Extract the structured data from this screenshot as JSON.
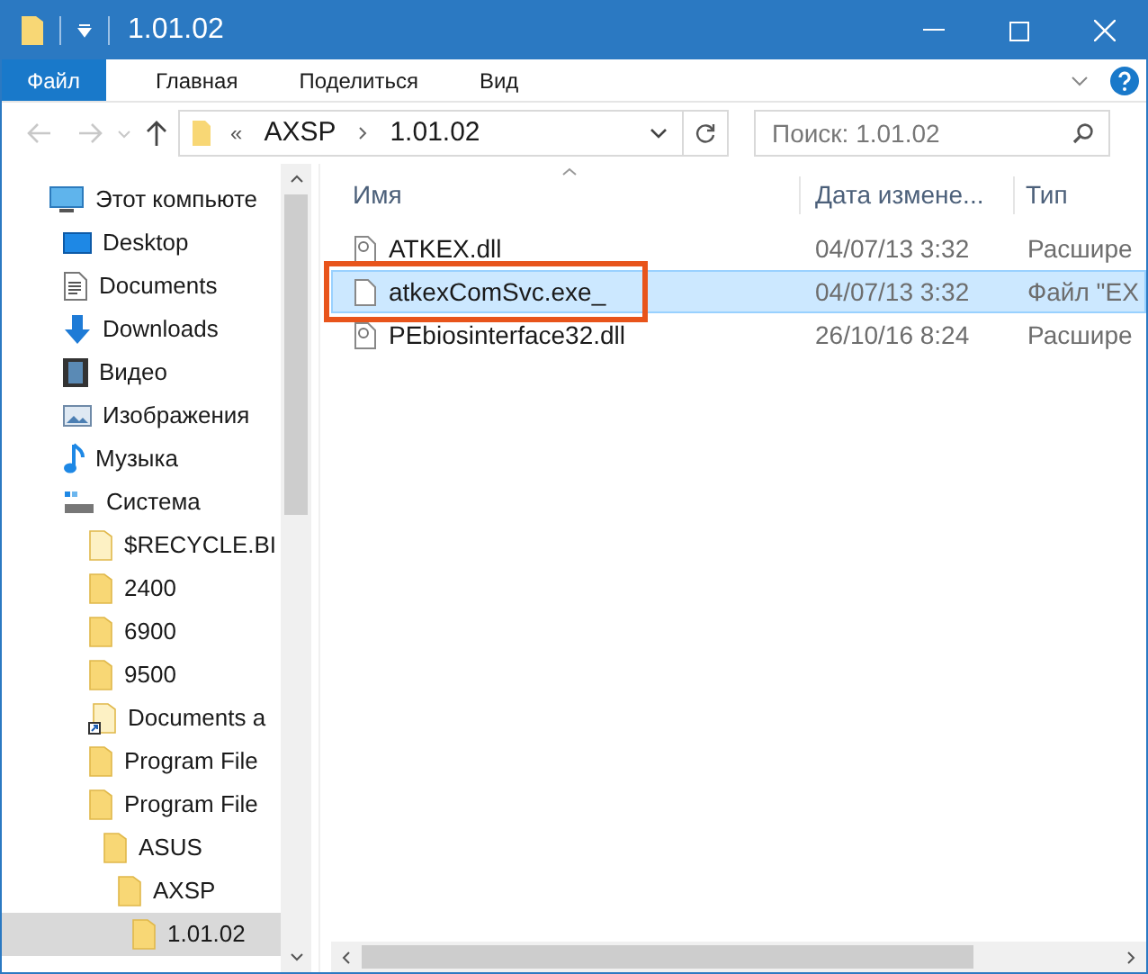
{
  "window": {
    "title": "1.01.02"
  },
  "ribbon_tabs": [
    {
      "label": "Файл",
      "kind": "file",
      "selected": false
    },
    {
      "label": "Главная",
      "kind": "tab",
      "selected": false
    },
    {
      "label": "Поделиться",
      "kind": "tab",
      "selected": false
    },
    {
      "label": "Вид",
      "kind": "tab",
      "selected": false
    }
  ],
  "address_bar": {
    "overflow": "«",
    "path": [
      "AXSP",
      "1.01.02"
    ]
  },
  "search": {
    "placeholder": "Поиск: 1.01.02"
  },
  "sidebar": {
    "items": [
      {
        "label": "Этот компьюте",
        "kind": "computer",
        "selected": false,
        "children": [
          {
            "label": "Desktop",
            "kind": "desktop",
            "selected": false
          },
          {
            "label": "Documents",
            "kind": "documents",
            "selected": false
          },
          {
            "label": "Downloads",
            "kind": "downloads",
            "selected": false
          },
          {
            "label": "Видео",
            "kind": "video",
            "selected": false
          },
          {
            "label": "Изображения",
            "kind": "pictures",
            "selected": false
          },
          {
            "label": "Музыка",
            "kind": "music",
            "selected": false
          },
          {
            "label": "Система",
            "kind": "drive",
            "selected": false,
            "children": [
              {
                "label": "$RECYCLE.BI",
                "kind": "folder-light",
                "selected": false
              },
              {
                "label": "2400",
                "kind": "folder",
                "selected": false
              },
              {
                "label": "6900",
                "kind": "folder",
                "selected": false
              },
              {
                "label": "9500",
                "kind": "folder",
                "selected": false
              },
              {
                "label": "Documents a",
                "kind": "shortcut",
                "selected": false
              },
              {
                "label": "Program File",
                "kind": "folder",
                "selected": false
              },
              {
                "label": "Program File",
                "kind": "folder",
                "selected": false,
                "children": [
                  {
                    "label": "ASUS",
                    "kind": "folder",
                    "selected": false,
                    "children": [
                      {
                        "label": "AXSP",
                        "kind": "folder",
                        "selected": false,
                        "children": [
                          {
                            "label": "1.01.02",
                            "kind": "folder",
                            "selected": true
                          }
                        ]
                      }
                    ]
                  }
                ]
              }
            ]
          }
        ]
      }
    ]
  },
  "file_list": {
    "columns": [
      "Имя",
      "Дата измене...",
      "Тип"
    ],
    "rows": [
      {
        "name": "ATKEX.dll",
        "date": "04/07/13 3:32",
        "type": "Расшире",
        "kind": "dll",
        "selected": false,
        "highlighted": false
      },
      {
        "name": "atkexComSvc.exe_",
        "date": "04/07/13 3:32",
        "type": "Файл \"EX",
        "kind": "file",
        "selected": true,
        "highlighted": true
      },
      {
        "name": "PEbiosinterface32.dll",
        "date": "26/10/16 8:24",
        "type": "Расшире",
        "kind": "dll",
        "selected": false,
        "highlighted": false
      }
    ]
  }
}
